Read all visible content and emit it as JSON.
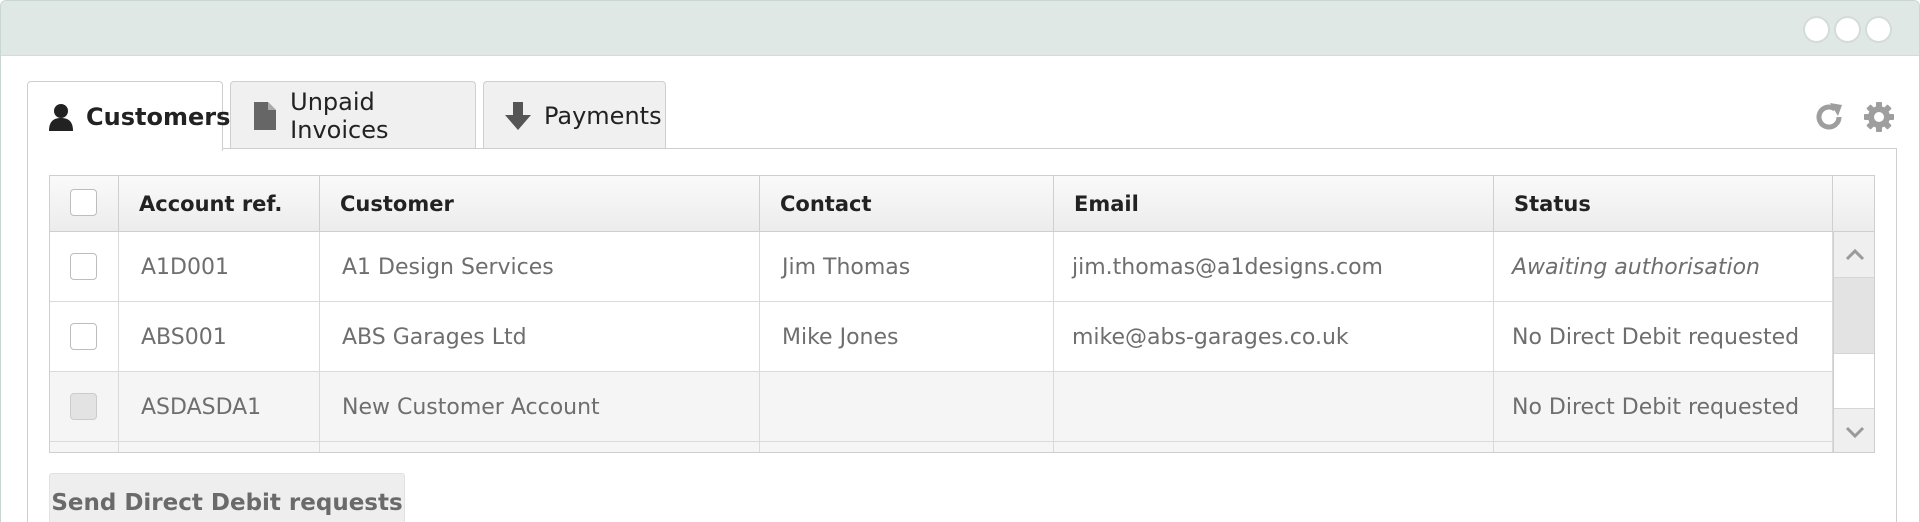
{
  "tabs": [
    {
      "label": "Customers",
      "icon": "user-icon",
      "active": true
    },
    {
      "label": "Unpaid Invoices",
      "icon": "document-icon",
      "active": false
    },
    {
      "label": "Payments",
      "icon": "download-arrow-icon",
      "active": false
    }
  ],
  "toolbar": {
    "refresh_icon": "refresh-icon",
    "settings_icon": "gear-icon"
  },
  "grid": {
    "columns": [
      "Account ref.",
      "Customer",
      "Contact",
      "Email",
      "Status"
    ],
    "rows": [
      {
        "account_ref": "A1D001",
        "customer": "A1 Design Services",
        "contact": "Jim Thomas",
        "email": "jim.thomas@a1designs.com",
        "status": "Awaiting authorisation",
        "checkbox_enabled": true
      },
      {
        "account_ref": "ABS001",
        "customer": "ABS Garages Ltd",
        "contact": "Mike Jones",
        "email": "mike@abs-garages.co.uk",
        "status": "No Direct Debit requested",
        "checkbox_enabled": true
      },
      {
        "account_ref": "ASDASDA1",
        "customer": "New Customer Account",
        "contact": "",
        "email": "",
        "status": "No Direct Debit requested",
        "checkbox_enabled": false
      }
    ]
  },
  "actions": {
    "send_label": "Send Direct Debit requests"
  },
  "colors": {
    "titlebar": "#dfe8e5",
    "icon_grey": "#9e9e9e",
    "text_muted": "#6e6e6e"
  }
}
